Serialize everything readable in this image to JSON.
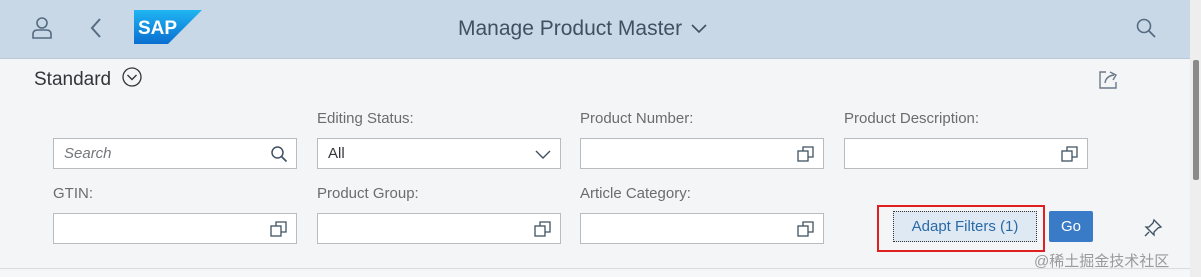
{
  "shell": {
    "brand": "SAP",
    "title": "Manage Product Master"
  },
  "variant": {
    "name": "Standard"
  },
  "filters": {
    "search": {
      "placeholder": "Search"
    },
    "editing_status": {
      "label": "Editing Status:",
      "value": "All"
    },
    "product_number": {
      "label": "Product Number:"
    },
    "product_description": {
      "label": "Product Description:"
    },
    "gtin": {
      "label": "GTIN:"
    },
    "product_group": {
      "label": "Product Group:"
    },
    "article_category": {
      "label": "Article Category:"
    }
  },
  "actions": {
    "adapt_filters": "Adapt Filters (1)",
    "go": "Go"
  },
  "watermark": "@稀土掘金技术社区",
  "colors": {
    "shell_bg": "#c9d8e6",
    "accent": "#3a7bc8",
    "highlight": "#e02020"
  },
  "icons": [
    "user-icon",
    "back-icon",
    "sap-logo",
    "chevron-down-icon",
    "search-icon",
    "share-icon",
    "value-help-icon",
    "pin-icon"
  ]
}
